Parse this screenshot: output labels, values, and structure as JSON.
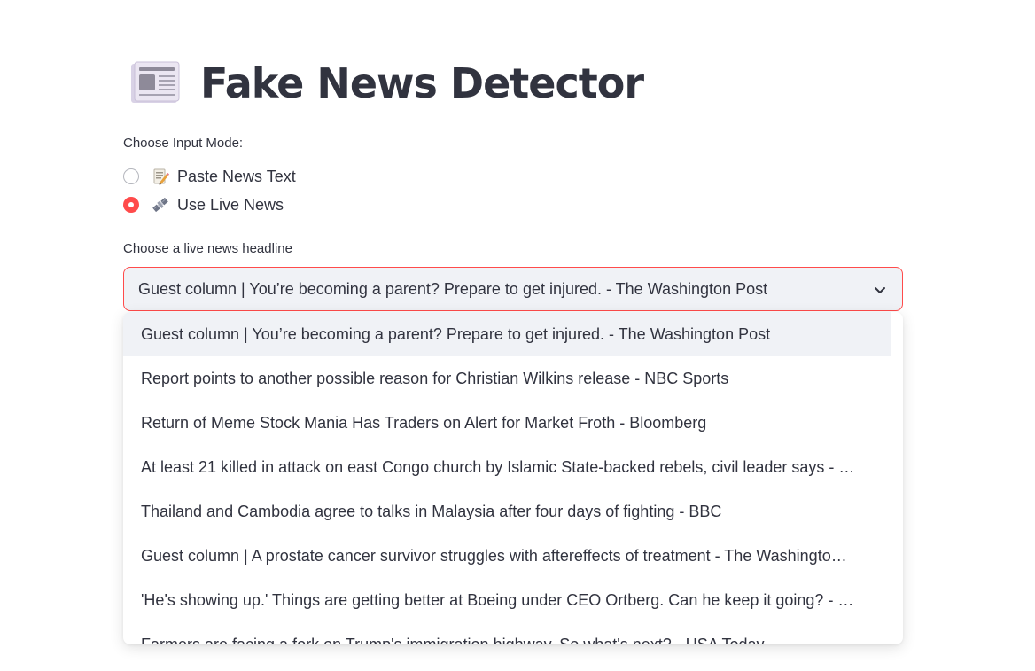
{
  "header": {
    "title": "Fake News Detector",
    "icon": "newspaper-icon"
  },
  "input_mode": {
    "label": "Choose Input Mode:",
    "options": [
      {
        "label": "Paste News Text",
        "icon": "memo-icon",
        "selected": false
      },
      {
        "label": "Use Live News",
        "icon": "satellite-icon",
        "selected": true
      }
    ]
  },
  "headline_select": {
    "label": "Choose a live news headline",
    "selected": "Guest column | You’re becoming a parent? Prepare to get injured. - The Washington Post",
    "options": [
      "Guest column | You’re becoming a parent? Prepare to get injured. - The Washington Post",
      "Report points to another possible reason for Christian Wilkins release - NBC Sports",
      "Return of Meme Stock Mania Has Traders on Alert for Market Froth - Bloomberg",
      "At least 21 killed in attack on east Congo church by Islamic State-backed rebels, civil leader says - …",
      "Thailand and Cambodia agree to talks in Malaysia after four days of fighting - BBC",
      "Guest column | A prostate cancer survivor struggles with aftereffects of treatment - The Washingto…",
      "'He's showing up.' Things are getting better at Boeing under CEO Ortberg. Can he keep it going? - …",
      "Farmers are facing a fork on Trump's immigration highway. So what's next? - USA Today"
    ]
  },
  "colors": {
    "accent": "#ff4b4b",
    "text": "#31333f",
    "select_bg": "#f0f2f6"
  }
}
